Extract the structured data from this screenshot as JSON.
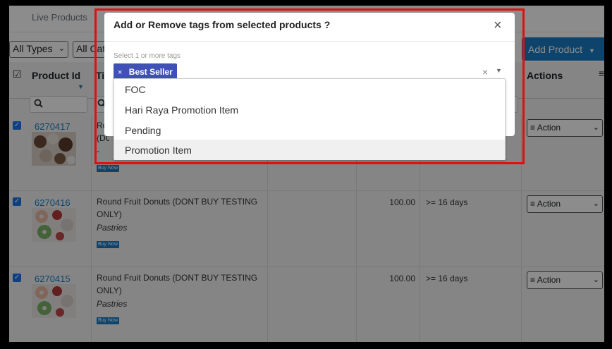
{
  "page": {
    "tab_live": "Live Products",
    "filter_types": "All Types",
    "filter_cat": "All Cat",
    "add_product": "Add Product",
    "headers": {
      "product_id": "Product Id",
      "title_partial": "Ti",
      "actions": "Actions"
    },
    "rows": [
      {
        "id": "6270417",
        "title": "Ro\n(DO\n-",
        "category": "",
        "buy_now": "Buy Now",
        "price": "",
        "days": "",
        "action": "Action"
      },
      {
        "id": "6270416",
        "title": "Round Fruit Donuts (DONT BUY TESTING ONLY)",
        "category": "Pastries",
        "buy_now": "Buy Now",
        "price": "100.00",
        "days": ">= 16 days",
        "action": "Action"
      },
      {
        "id": "6270415",
        "title": "Round Fruit Donuts (DONT BUY TESTING ONLY)",
        "category": "Pastries",
        "buy_now": "Buy Now",
        "price": "100.00",
        "days": ">= 16 days",
        "action": "Action"
      }
    ]
  },
  "modal": {
    "title": "Add or Remove tags from selected products ?",
    "close": "×",
    "hint": "Select 1 or more tags",
    "selected_tags": [
      "Best Seller"
    ],
    "chip_remove": "×",
    "clear": "×",
    "options": [
      "FOC",
      "Hari Raya Promotion Item",
      "Pending",
      "Promotion Item"
    ],
    "highlighted_option": "Promotion Item"
  },
  "colors": {
    "accent": "#1a7dc4",
    "chip": "#3f51b5",
    "highlight_box": "#e01010"
  }
}
